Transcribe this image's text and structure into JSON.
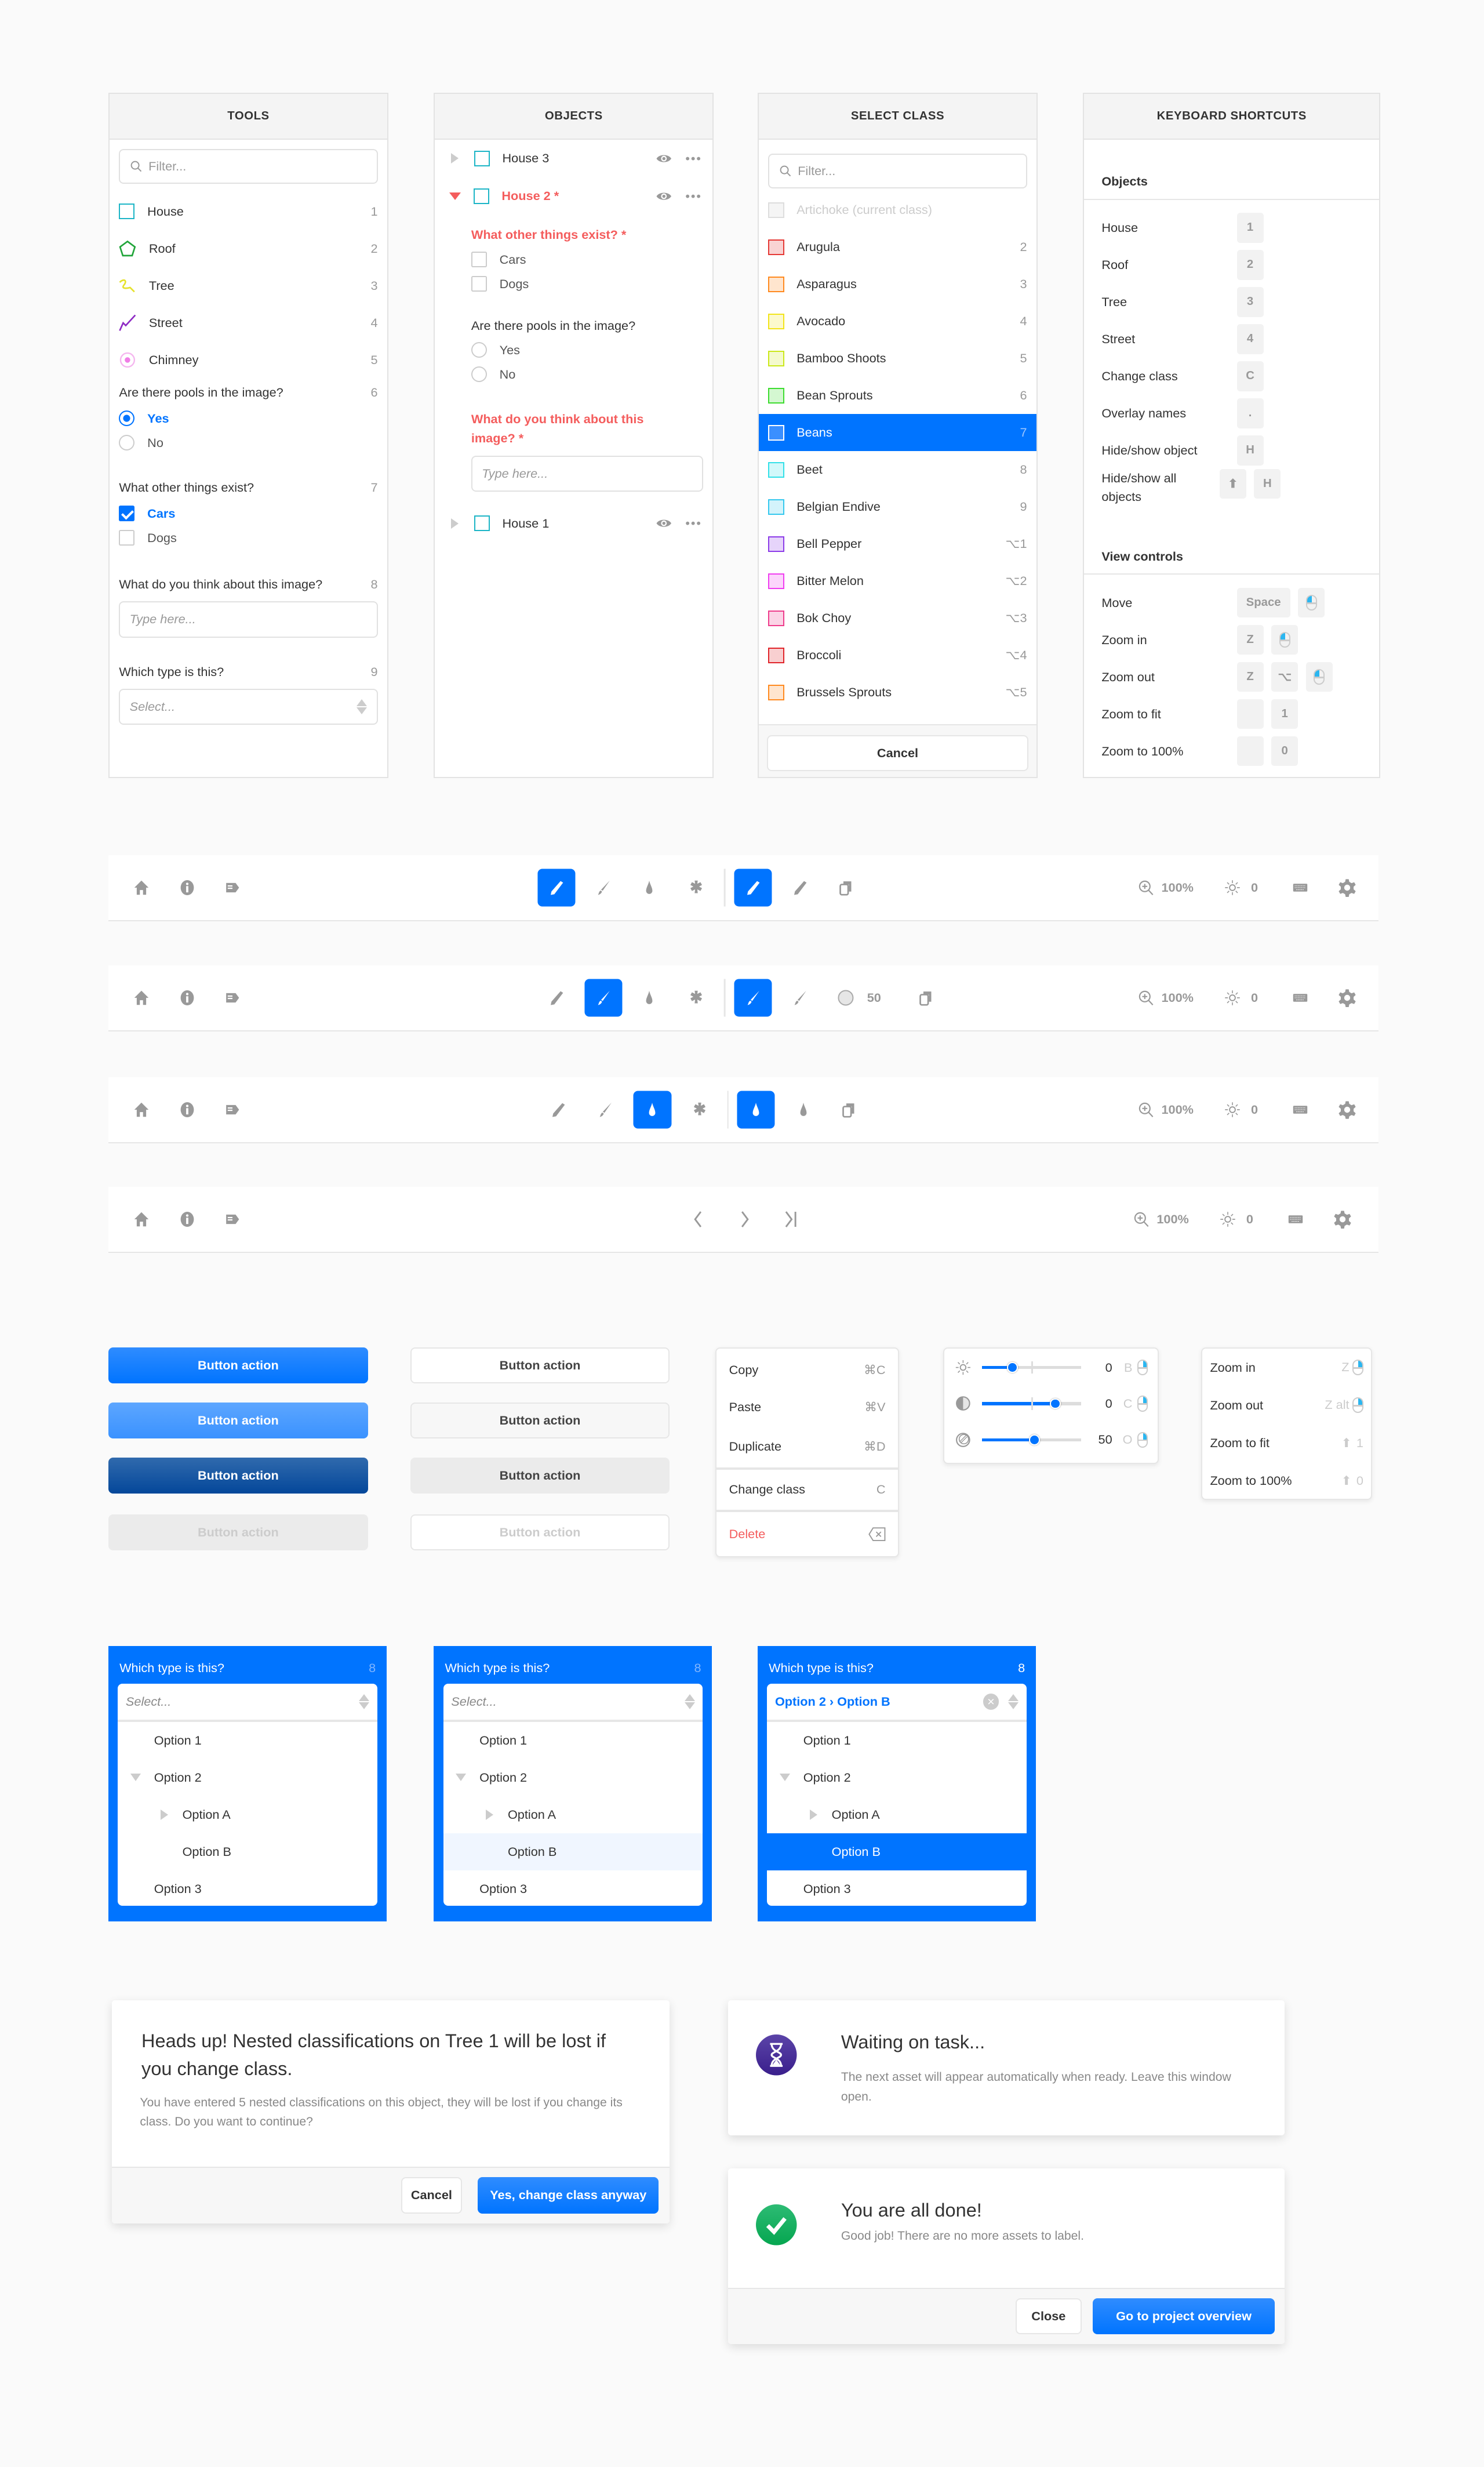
{
  "colors": {
    "accent": "#0074ff",
    "danger": "#f45d5d",
    "teal": "#1cb5c6"
  },
  "tools": {
    "title": "TOOLS",
    "filter_placeholder": "Filter...",
    "items": [
      {
        "label": "House",
        "key": "1",
        "icon": "square-icon",
        "color": "#1cb5c6"
      },
      {
        "label": "Roof",
        "key": "2",
        "icon": "polygon-icon",
        "color": "#21a53a"
      },
      {
        "label": "Tree",
        "key": "3",
        "icon": "freehand-icon",
        "color": "#e6e22c"
      },
      {
        "label": "Street",
        "key": "4",
        "icon": "polyline-icon",
        "color": "#8e2bc4"
      },
      {
        "label": "Chimney",
        "key": "5",
        "icon": "point-icon",
        "color": "#f07ee6"
      }
    ],
    "q_pools": {
      "label": "Are there pools in the image?",
      "key": "6",
      "options": [
        "Yes",
        "No"
      ],
      "selected": "Yes"
    },
    "q_things": {
      "label": "What other things exist?",
      "key": "7",
      "options": [
        "Cars",
        "Dogs"
      ],
      "checked": [
        "Cars"
      ]
    },
    "q_think": {
      "label": "What do you think about this image?",
      "key": "8",
      "placeholder": "Type here..."
    },
    "q_type": {
      "label": "Which type is this?",
      "key": "9",
      "placeholder": "Select..."
    }
  },
  "objects": {
    "title": "OBJECTS",
    "house3": "House 3",
    "house2": "House 2 *",
    "house1": "House 1",
    "q_things": {
      "label": "What other things exist? *",
      "options": [
        "Cars",
        "Dogs"
      ]
    },
    "q_pools": {
      "label": "Are there pools in the image?",
      "options": [
        "Yes",
        "No"
      ]
    },
    "q_think": {
      "label": "What do you think about this image? *",
      "placeholder": "Type here..."
    }
  },
  "select_class": {
    "title": "SELECT CLASS",
    "filter_placeholder": "Filter...",
    "current": "Artichoke (current class)",
    "items": [
      {
        "label": "Arugula",
        "key": "2",
        "color": "#e53935"
      },
      {
        "label": "Asparagus",
        "key": "3",
        "color": "#ff8a1f"
      },
      {
        "label": "Avocado",
        "key": "4",
        "color": "#f2e41b"
      },
      {
        "label": "Bamboo Shoots",
        "key": "5",
        "color": "#cbe81b"
      },
      {
        "label": "Bean Sprouts",
        "key": "6",
        "color": "#3ddc2f"
      },
      {
        "label": "Beans",
        "key": "7",
        "color": "#ffffff",
        "selected": true
      },
      {
        "label": "Beet",
        "key": "8",
        "color": "#33e0e8"
      },
      {
        "label": "Belgian Endive",
        "key": "9",
        "color": "#35c8ee"
      },
      {
        "label": "Bell Pepper",
        "key": "⌥1",
        "color": "#8c3be8"
      },
      {
        "label": "Bitter Melon",
        "key": "⌥2",
        "color": "#f03ef0"
      },
      {
        "label": "Bok Choy",
        "key": "⌥3",
        "color": "#ee3d8c"
      },
      {
        "label": "Broccoli",
        "key": "⌥4",
        "color": "#e0242a"
      },
      {
        "label": "Brussels Sprouts",
        "key": "⌥5",
        "color": "#ff8a1f"
      }
    ],
    "cancel": "Cancel"
  },
  "shortcuts": {
    "title": "KEYBOARD SHORTCUTS",
    "objects_heading": "Objects",
    "objects": [
      {
        "label": "House",
        "keys": [
          "1"
        ]
      },
      {
        "label": "Roof",
        "keys": [
          "2"
        ]
      },
      {
        "label": "Tree",
        "keys": [
          "3"
        ]
      },
      {
        "label": "Street",
        "keys": [
          "4"
        ]
      },
      {
        "label": "Change class",
        "keys": [
          "C"
        ]
      },
      {
        "label": "Overlay names",
        "keys": [
          "."
        ]
      },
      {
        "label": "Hide/show object",
        "keys": [
          "H"
        ]
      },
      {
        "label": "Hide/show all objects",
        "keys": [
          "shift-icon",
          "H"
        ]
      }
    ],
    "view_heading": "View controls",
    "view": [
      {
        "label": "Move",
        "keys": [
          "Space",
          "mouse-icon"
        ]
      },
      {
        "label": "Zoom in",
        "keys": [
          "Z",
          "mouse-icon"
        ]
      },
      {
        "label": "Zoom out",
        "keys": [
          "Z",
          "⌥",
          "mouse-icon"
        ]
      },
      {
        "label": "Zoom to fit",
        "keys": [
          "",
          "1"
        ]
      },
      {
        "label": "Zoom to 100%",
        "keys": [
          "",
          "0"
        ]
      }
    ]
  },
  "toolbars": [
    {
      "active_tool": "pencil",
      "zoom": "100%",
      "brightness": "0"
    },
    {
      "active_tool": "brush",
      "brush_size": "50",
      "zoom": "100%",
      "brightness": "0"
    },
    {
      "active_tool": "fill",
      "zoom": "100%",
      "brightness": "0"
    },
    {
      "zoom": "100%",
      "brightness": "0"
    }
  ],
  "buttons": {
    "label": "Button action",
    "states": [
      "default",
      "hover",
      "pressed",
      "disabled"
    ]
  },
  "context_menu": [
    {
      "label": "Copy",
      "shortcut": "⌘C"
    },
    {
      "label": "Paste",
      "shortcut": "⌘V"
    },
    {
      "label": "Duplicate",
      "shortcut": "⌘D"
    },
    {
      "label": "Change class",
      "shortcut": "C"
    },
    {
      "label": "Delete",
      "shortcut": "delete-icon"
    }
  ],
  "sliders": [
    {
      "icon": "brightness-icon",
      "value": "0",
      "key": "B",
      "level": 0.31
    },
    {
      "icon": "contrast-icon",
      "value": "0",
      "key": "C",
      "level": 0.74
    },
    {
      "icon": "opacity-icon",
      "value": "50",
      "key": "O",
      "level": 0.53
    }
  ],
  "zoom_menu": [
    {
      "label": "Zoom in",
      "shortcut": "Z"
    },
    {
      "label": "Zoom out",
      "shortcut": "Z alt"
    },
    {
      "label": "Zoom to fit",
      "shortcut": "1"
    },
    {
      "label": "Zoom to 100%",
      "shortcut": "0"
    }
  ],
  "dropdowns": [
    {
      "title": "Which type is this?",
      "key": "8",
      "value": "Select...",
      "options": [
        "Option 1",
        "Option 2",
        "Option A",
        "Option B",
        "Option 3"
      ],
      "state": "open"
    },
    {
      "title": "Which type is this?",
      "key": "8",
      "value": "Select...",
      "options": [
        "Option 1",
        "Option 2",
        "Option A",
        "Option B",
        "Option 3"
      ],
      "state": "hover",
      "hovered": "Option B"
    },
    {
      "title": "Which type is this?",
      "key": "8",
      "value_parent": "Option 2",
      "value_child": "Option B",
      "options": [
        "Option 1",
        "Option 2",
        "Option A",
        "Option B",
        "Option 3"
      ],
      "state": "selected",
      "selected": "Option B"
    }
  ],
  "dialogs": {
    "change_class": {
      "title": "Heads up! Nested classifications on Tree 1 will be lost if you change class.",
      "body": "You have entered 5 nested classifications on this object, they will be lost if you change its class. Do you want to continue?",
      "cancel": "Cancel",
      "confirm": "Yes, change class anyway"
    },
    "waiting": {
      "title": "Waiting on task...",
      "body": "The next asset will appear automatically when ready. Leave this window open."
    },
    "done": {
      "title": "You are all done!",
      "body": "Good job! There are no more assets to label.",
      "close": "Close",
      "primary": "Go to project overview"
    }
  }
}
